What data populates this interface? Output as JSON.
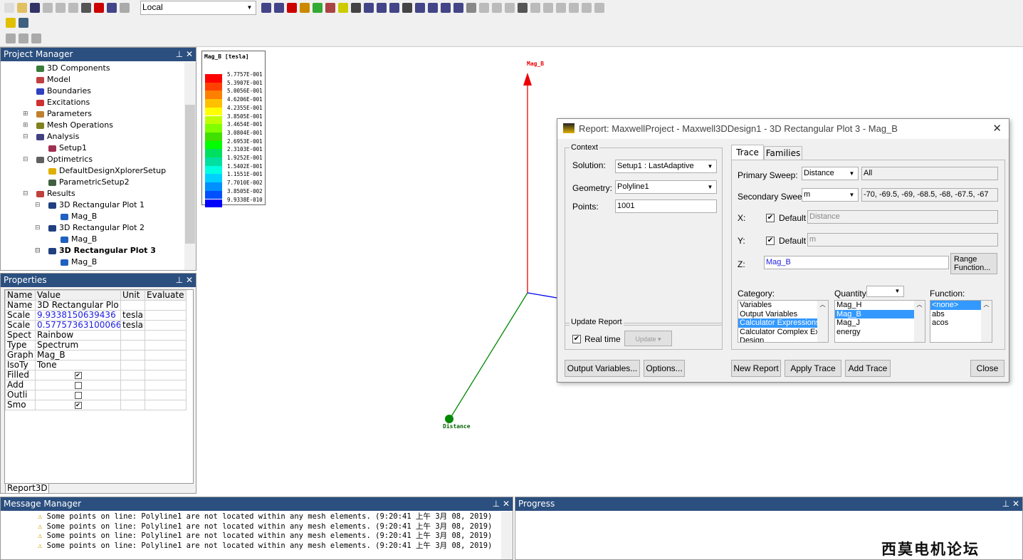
{
  "toolbar": {
    "solver_location": "Local"
  },
  "project_manager": {
    "title": "Project Manager",
    "items": [
      {
        "label": "3D Components",
        "level": 2,
        "color": "#3a7a3a"
      },
      {
        "label": "Model",
        "level": 2,
        "color": "#c04040"
      },
      {
        "label": "Boundaries",
        "level": 2,
        "color": "#3040c0"
      },
      {
        "label": "Excitations",
        "level": 2,
        "color": "#d03030"
      },
      {
        "label": "Parameters",
        "level": 2,
        "color": "#c08030",
        "expand": "+"
      },
      {
        "label": "Mesh Operations",
        "level": 2,
        "color": "#808020",
        "expand": "+"
      },
      {
        "label": "Analysis",
        "level": 2,
        "color": "#404080",
        "expand": "-"
      },
      {
        "label": "Setup1",
        "level": 3,
        "color": "#a03050"
      },
      {
        "label": "Optimetrics",
        "level": 2,
        "color": "#606060",
        "expand": "-"
      },
      {
        "label": "DefaultDesignXplorerSetup",
        "level": 3,
        "color": "#e0b000"
      },
      {
        "label": "ParametricSetup2",
        "level": 3,
        "color": "#406040"
      },
      {
        "label": "Results",
        "level": 2,
        "color": "#c04040",
        "expand": "-"
      },
      {
        "label": "3D Rectangular Plot 1",
        "level": 3,
        "color": "#204080",
        "expand": "-"
      },
      {
        "label": "Mag_B",
        "level": 4,
        "color": "#2060c0"
      },
      {
        "label": "3D Rectangular Plot 2",
        "level": 3,
        "color": "#204080",
        "expand": "-"
      },
      {
        "label": "Mag_B",
        "level": 4,
        "color": "#2060c0"
      },
      {
        "label": "3D Rectangular Plot 3",
        "level": 3,
        "color": "#204080",
        "expand": "-",
        "bold": true
      },
      {
        "label": "Mag_B",
        "level": 4,
        "color": "#2060c0"
      }
    ]
  },
  "properties": {
    "title": "Properties",
    "headers": [
      "Name",
      "Value",
      "Unit",
      "Evaluate"
    ],
    "rows": [
      {
        "name": "Name",
        "value": "3D Rectangular Plo",
        "unit": ""
      },
      {
        "name": "Scale",
        "value": "9.9338150639436",
        "unit": "tesla",
        "blue": true
      },
      {
        "name": "Scale",
        "value": "0.57757363100066",
        "unit": "tesla",
        "blue": true
      },
      {
        "name": "Spect",
        "value": "Rainbow",
        "unit": ""
      },
      {
        "name": "Type",
        "value": "Spectrum",
        "unit": ""
      },
      {
        "name": "Graph",
        "value": "Mag_B",
        "unit": ""
      },
      {
        "name": "IsoTy",
        "value": "Tone",
        "unit": ""
      },
      {
        "name": "Filled",
        "value": "",
        "unit": "",
        "check": true
      },
      {
        "name": "Add",
        "value": "",
        "unit": "",
        "check": false
      },
      {
        "name": "Outli",
        "value": "",
        "unit": "",
        "check": false
      },
      {
        "name": "Smo",
        "value": "",
        "unit": "",
        "check": true
      }
    ],
    "tab": "Report3D"
  },
  "legend": {
    "title": "Mag_B [tesla]",
    "values": [
      "5.7757E-001",
      "5.3907E-001",
      "5.0056E-001",
      "4.6206E-001",
      "4.2355E-001",
      "3.8505E-001",
      "3.4654E-001",
      "3.0804E-001",
      "2.6953E-001",
      "2.3103E-001",
      "1.9252E-001",
      "1.5402E-001",
      "1.1551E-001",
      "7.7010E-002",
      "3.8505E-002",
      "9.9338E-010"
    ],
    "colors": [
      "#ff0000",
      "#ff4000",
      "#ff8000",
      "#ffc000",
      "#ffff00",
      "#c0ff00",
      "#80ff00",
      "#40e000",
      "#00ff00",
      "#00e060",
      "#00e0a0",
      "#00ffe0",
      "#00d0ff",
      "#0090ff",
      "#0050ff",
      "#0000ff"
    ]
  },
  "viewport": {
    "axis_z_label": "Mag_B",
    "axis_x_label": "Distance"
  },
  "dialog": {
    "title": "Report: MaxwellProject - Maxwell3DDesign1 - 3D Rectangular Plot 3 - Mag_B",
    "context": {
      "group": "Context",
      "solution_label": "Solution:",
      "solution": "Setup1 : LastAdaptive",
      "geometry_label": "Geometry:",
      "geometry": "Polyline1",
      "points_label": "Points:",
      "points": "1001"
    },
    "update": {
      "group": "Update Report",
      "realtime": "Real time",
      "update_btn": "Update"
    },
    "tabs": [
      "Trace",
      "Families"
    ],
    "primary_sweep_label": "Primary Sweep:",
    "primary_sweep": "Distance",
    "primary_values": "All",
    "secondary_sweep_label": "Secondary Sweep:",
    "secondary_sweep": "m",
    "secondary_values": "-70, -69.5, -69, -68.5, -68, -67.5, -67",
    "x_label": "X:",
    "y_label": "Y:",
    "default_label": "Default",
    "x_value": "Distance",
    "y_value": "m",
    "z_label": "Z:",
    "z_value": "Mag_B",
    "range_function": "Range Function...",
    "category_label": "Category:",
    "categories": [
      "Variables",
      "Output Variables",
      "Calculator Expressions",
      "Calculator Complex Exp",
      "Design"
    ],
    "quantity_label": "Quantity:",
    "quantities": [
      "Mag_H",
      "Mag_B",
      "Mag_J",
      "energy"
    ],
    "function_label": "Function:",
    "functions": [
      "<none>",
      "abs",
      "acos"
    ],
    "buttons": {
      "output_variables": "Output Variables...",
      "options": "Options...",
      "new_report": "New Report",
      "apply_trace": "Apply Trace",
      "add_trace": "Add Trace",
      "close": "Close"
    }
  },
  "message_manager": {
    "title": "Message Manager",
    "messages": [
      "Some points on line: Polyline1 are not located within any mesh elements. (9:20:41 上午  3月 08, 2019)",
      "Some points on line: Polyline1 are not located within any mesh elements. (9:20:41 上午  3月 08, 2019)",
      "Some points on line: Polyline1 are not located within any mesh elements. (9:20:41 上午  3月 08, 2019)",
      "Some points on line: Polyline1 are not located within any mesh elements. (9:20:41 上午  3月 08, 2019)"
    ]
  },
  "progress": {
    "title": "Progress"
  },
  "watermark": "西莫电机论坛"
}
